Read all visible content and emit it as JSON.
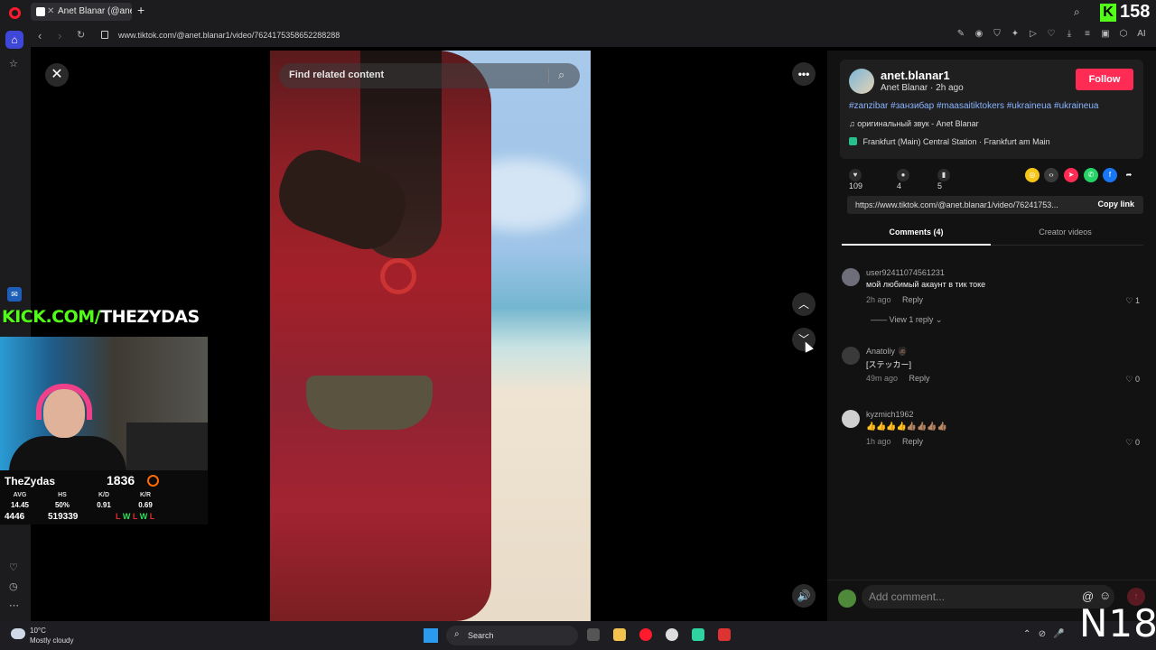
{
  "browser": {
    "tab_title": "Anet Blanar (@anet.bl",
    "url": "www.tiktok.com/@anet.blanar1/video/7624175358652288288",
    "overlay_counter": "158",
    "ai_label": "AI"
  },
  "video": {
    "search_placeholder": "Find related content"
  },
  "stream_overlay": {
    "kick_prefix": "KICK.COM/",
    "kick_handle": "THEZYDAS",
    "streamer": "TheZydas",
    "elo": "1836",
    "stats": [
      {
        "label": "AVG",
        "value": "14.45"
      },
      {
        "label": "HS",
        "value": "50%"
      },
      {
        "label": "K/D",
        "value": "0.91"
      },
      {
        "label": "K/R",
        "value": "0.69"
      }
    ],
    "bottom_left": "4446",
    "bottom_mid": "519339",
    "recent": [
      "L",
      "W",
      "L",
      "W",
      "L"
    ]
  },
  "post": {
    "username": "anet.blanar1",
    "display_name": "Anet Blanar",
    "posted": "2h ago",
    "follow_label": "Follow",
    "hashtags": "#zanzibar #занзибар #maasaitiktokers #ukraineua #ukraineua",
    "sound": "оригинальный звук - Anet Blanar",
    "location": "Frankfurt (Main) Central Station · Frankfurt am Main",
    "likes": "109",
    "comments": "4",
    "saves": "5",
    "link": "https://www.tiktok.com/@anet.blanar1/video/76241753...",
    "copy_link_label": "Copy link"
  },
  "tabs": {
    "comments": "Comments (4)",
    "creator": "Creator videos"
  },
  "comments": [
    {
      "user": "user92411074561231",
      "text": "мой любимый акаунт в тик токе",
      "time": "2h ago",
      "reply": "Reply",
      "likes": "1",
      "view_replies": "View 1 reply"
    },
    {
      "user": "Anatoliy 🧔🏿",
      "text": "[ステッカー]",
      "time": "49m ago",
      "reply": "Reply",
      "likes": "0"
    },
    {
      "user": "kyzmich1962",
      "text": "👍👍👍👍👍🏽👍🏽👍🏽👍🏽",
      "time": "1h ago",
      "reply": "Reply",
      "likes": "0"
    }
  ],
  "comment_input": {
    "placeholder": "Add comment..."
  },
  "taskbar": {
    "temp": "10°C",
    "condition": "Mostly cloudy",
    "search": "Search",
    "watermark": "N18"
  },
  "colors": {
    "follow": "#fe2c55",
    "kick_green": "#53fc18",
    "hashtag": "#8ab4ff"
  }
}
